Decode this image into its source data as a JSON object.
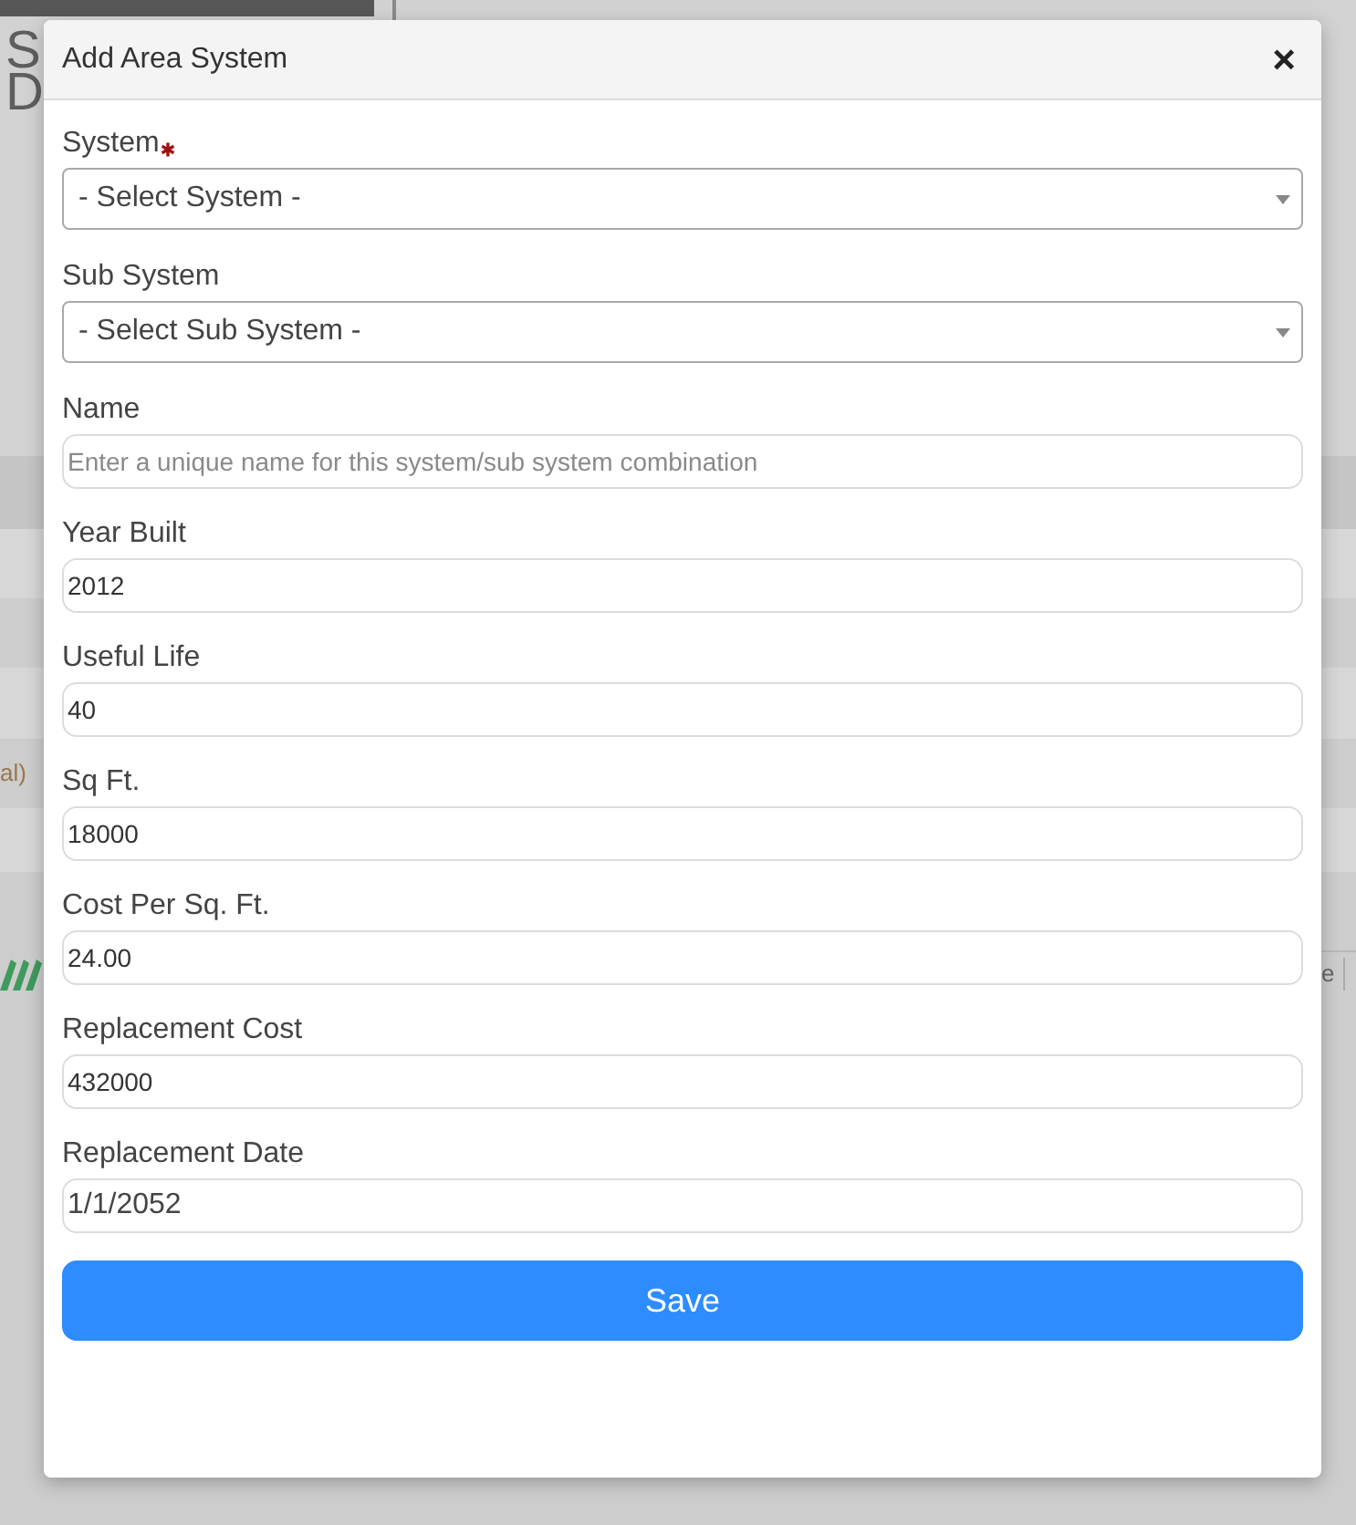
{
  "background": {
    "logo_letters": [
      "S",
      "D"
    ],
    "row_fragment": "al)",
    "toolbar_fragment": "e"
  },
  "modal": {
    "title": "Add Area System",
    "close": "×",
    "fields": [
      {
        "kind": "select",
        "label": "System",
        "required": true,
        "value": "- Select System -"
      },
      {
        "kind": "select",
        "label": "Sub System",
        "required": false,
        "value": "- Select Sub System -"
      },
      {
        "kind": "text",
        "label": "Name",
        "required": false,
        "placeholder": "Enter a unique name for this system/sub system combination"
      },
      {
        "kind": "text",
        "label": "Year Built",
        "required": false,
        "value": "2012"
      },
      {
        "kind": "text",
        "label": "Useful Life",
        "required": false,
        "value": "40"
      },
      {
        "kind": "text",
        "label": "Sq Ft.",
        "required": false,
        "value": "18000"
      },
      {
        "kind": "text",
        "label": "Cost Per Sq. Ft.",
        "required": false,
        "value": "24.00"
      },
      {
        "kind": "text",
        "label": "Replacement Cost",
        "required": false,
        "value": "432000"
      },
      {
        "kind": "date",
        "label": "Replacement Date",
        "required": false,
        "value": "1/1/2052"
      }
    ],
    "save_button": "Save"
  }
}
